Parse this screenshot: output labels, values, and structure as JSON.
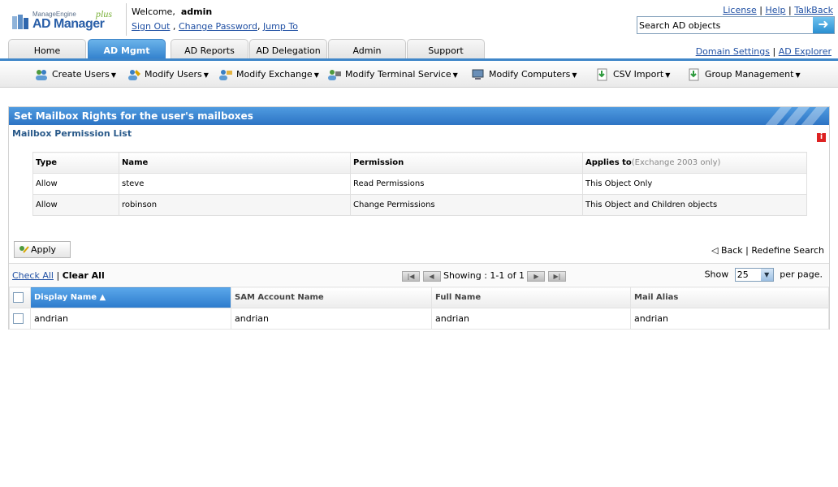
{
  "header": {
    "logo": {
      "small": "ManageEngine",
      "product": "AD Manager",
      "plus": "plus"
    },
    "welcome_prefix": "Welcome,",
    "user": "admin",
    "links": {
      "sign_out": "Sign Out",
      "change_password": "Change Password",
      "jump_to": "Jump To"
    },
    "top_links": {
      "license": "License",
      "help": "Help",
      "talkback": "TalkBack"
    },
    "search": {
      "placeholder": "Search AD objects",
      "value": "Search AD objects"
    }
  },
  "tabs": [
    {
      "label": "Home",
      "active": false
    },
    {
      "label": "AD Mgmt",
      "active": true
    },
    {
      "label": "AD Reports",
      "active": false
    },
    {
      "label": "AD Delegation",
      "active": false
    },
    {
      "label": "Admin",
      "active": false
    },
    {
      "label": "Support",
      "active": false
    }
  ],
  "tab_links": {
    "domain_settings": "Domain Settings",
    "ad_explorer": "AD Explorer"
  },
  "toolbar": [
    {
      "label": "Create Users",
      "icon": "users-icon"
    },
    {
      "label": "Modify Users",
      "icon": "modify-users-icon"
    },
    {
      "label": "Modify Exchange",
      "icon": "exchange-icon"
    },
    {
      "label": "Modify Terminal Service",
      "icon": "terminal-service-icon"
    },
    {
      "label": "Modify Computers",
      "icon": "computer-icon"
    },
    {
      "label": "CSV Import",
      "icon": "csv-import-icon"
    },
    {
      "label": "Group Management",
      "icon": "group-management-icon"
    }
  ],
  "panel": {
    "title": "Set Mailbox Rights for the user's mailboxes",
    "subtitle": "Mailbox Permission List",
    "info_icon": "i",
    "perm_headers": {
      "type": "Type",
      "name": "Name",
      "permission": "Permission",
      "applies_to": "Applies to",
      "applies_note": "(Exchange 2003 only)"
    },
    "perm_rows": [
      {
        "type": "Allow",
        "name": "steve",
        "permission": "Read Permissions",
        "applies_to": "This Object Only"
      },
      {
        "type": "Allow",
        "name": "robinson",
        "permission": "Change Permissions",
        "applies_to": "This Object and Children objects"
      }
    ],
    "apply_label": "Apply",
    "back_label": "Back",
    "redefine_label": "Redefine Search"
  },
  "list": {
    "check_all": "Check All",
    "clear_all": "Clear All",
    "showing": "Showing : 1-1 of 1",
    "show_label": "Show",
    "per_page_value": "25",
    "per_page_label": "per page.",
    "headers": {
      "display_name": "Display Name",
      "sam": "SAM Account Name",
      "full_name": "Full Name",
      "mail_alias": "Mail Alias"
    },
    "rows": [
      {
        "display_name": "andrian",
        "sam": "andrian",
        "full_name": "andrian",
        "mail_alias": "andrian"
      }
    ]
  }
}
